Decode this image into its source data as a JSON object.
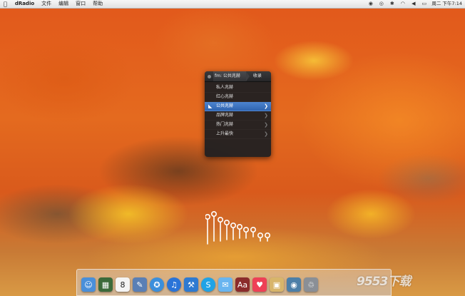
{
  "menubar": {
    "app_name": "dRadio",
    "menus": [
      "文件",
      "编辑",
      "窗口",
      "帮助"
    ],
    "clock": "周二 下午7:14"
  },
  "panel": {
    "breadcrumb": "fm: 公共兆赫",
    "tab": "收录",
    "channels": [
      {
        "label": "私人兆赫",
        "selected": false,
        "has_arrow": false
      },
      {
        "label": "红心兆赫",
        "selected": false,
        "has_arrow": false
      },
      {
        "label": "公共兆赫",
        "selected": true,
        "has_arrow": true
      },
      {
        "label": "品牌兆赫",
        "selected": false,
        "has_arrow": true
      },
      {
        "label": "热门兆赫",
        "selected": false,
        "has_arrow": true
      },
      {
        "label": "上升最快",
        "selected": false,
        "has_arrow": true
      }
    ]
  },
  "dock": {
    "apps": [
      {
        "name": "finder-icon",
        "glyph": "☺",
        "color": "#4a8fd9"
      },
      {
        "name": "mission-control-icon",
        "glyph": "▦",
        "color": "#3b6a3a"
      },
      {
        "name": "calendar-icon",
        "glyph": "8",
        "color": "#f4f4f4"
      },
      {
        "name": "preview-icon",
        "glyph": "✎",
        "color": "#5a7fb5"
      },
      {
        "name": "safari-icon",
        "glyph": "✪",
        "color": "#3b8fdc"
      },
      {
        "name": "itunes-icon",
        "glyph": "♫",
        "color": "#2a74d8"
      },
      {
        "name": "xcode-icon",
        "glyph": "⚒",
        "color": "#2e7ad1"
      },
      {
        "name": "skype-icon",
        "glyph": "S",
        "color": "#1fa3e6"
      },
      {
        "name": "messages-icon",
        "glyph": "✉",
        "color": "#69b5f0"
      },
      {
        "name": "dictionary-icon",
        "glyph": "Aa",
        "color": "#8b2b2b"
      },
      {
        "name": "pocket-icon",
        "glyph": "♥",
        "color": "#ee4056"
      },
      {
        "name": "package-icon",
        "glyph": "▣",
        "color": "#d8b56a"
      },
      {
        "name": "camera-icon",
        "glyph": "◉",
        "color": "#4c7fa8"
      },
      {
        "name": "trash-icon",
        "glyph": "♲",
        "color": "#8a8f96"
      }
    ]
  },
  "watermark": "9553下载"
}
